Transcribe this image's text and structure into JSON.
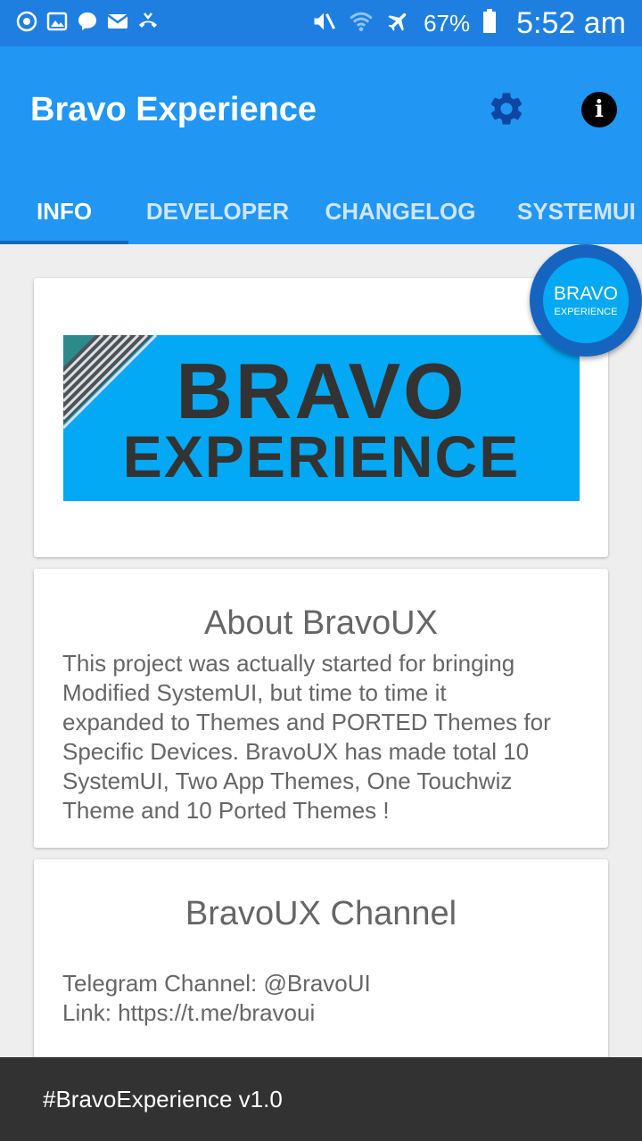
{
  "status_bar": {
    "left_icons": [
      "sync-icon",
      "image-icon",
      "messenger-icon",
      "mail-icon",
      "call-notification-icon"
    ],
    "right_icons": [
      "mute-icon",
      "wifi-icon",
      "airplane-icon",
      "battery-icon"
    ],
    "battery": "67%",
    "time": "5:52 am"
  },
  "app_bar": {
    "title": "Bravo Experience",
    "settings_icon": "gear-icon",
    "info_icon": "info-icon",
    "info_glyph": "i"
  },
  "tabs": [
    {
      "label": "INFO",
      "active": true
    },
    {
      "label": "DEVELOPER",
      "active": false
    },
    {
      "label": "CHANGELOG",
      "active": false
    },
    {
      "label": "SYSTEMUI",
      "active": false
    }
  ],
  "fab_logo": {
    "line1": "BRAVO",
    "line2": "EXPERIENCE"
  },
  "banner": {
    "line1": "BRAVO",
    "line2": "EXPERIENCE"
  },
  "about_card": {
    "title": "About BravoUX",
    "lines": [
      "This project was actually started for bringing",
      "Modified SystemUI, but time to time it",
      "expanded to Themes and PORTED Themes for",
      "Specific Devices. BravoUX has made total 10",
      "SystemUI, Two App Themes, One Touchwiz",
      "Theme and 10 Ported Themes !"
    ]
  },
  "channel_card": {
    "title": "BravoUX Channel",
    "telegram": "Telegram Channel: @BravoUI",
    "link": "Link: https://t.me/bravoui"
  },
  "bottom_bar": {
    "text": "#BravoExperience v1.0"
  },
  "colors": {
    "status_bar": "#1f7fe0",
    "app_bar": "#2196f3",
    "tab_indicator": "#1565c0",
    "banner": "#03a9f4",
    "bottom_bar": "#323232"
  }
}
